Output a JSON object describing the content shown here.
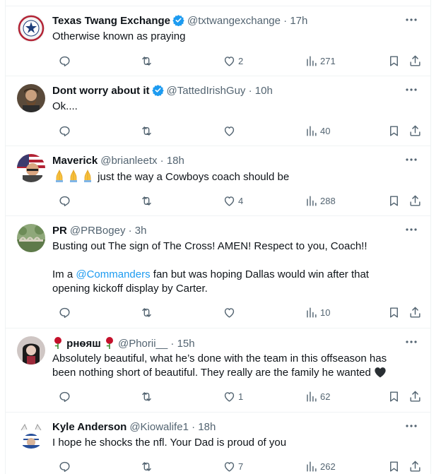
{
  "accent_color": "#1d9bf0",
  "tweets": [
    {
      "name": "Texas Twang Exchange",
      "handle": "@txtwangexchange",
      "time": "17h",
      "verified": true,
      "text": [
        "Otherwise known as praying"
      ],
      "replies": "",
      "retweets": "",
      "likes": "2",
      "views": "271"
    },
    {
      "name": "Dont worry about it",
      "handle": "@TattedIrishGuy",
      "time": "10h",
      "verified": true,
      "text": [
        "Ok...."
      ],
      "replies": "",
      "retweets": "",
      "likes": "",
      "views": "40"
    },
    {
      "name": "Maverick",
      "handle": "@brianleetx",
      "time": "18h",
      "verified": false,
      "text": [
        "just the way a Cowboys coach should be"
      ],
      "replies": "",
      "retweets": "",
      "likes": "4",
      "views": "288"
    },
    {
      "name": "PR",
      "handle": "@PRBogey",
      "time": "3h",
      "verified": false,
      "text": [
        "Busting out The sign of The Cross! AMEN!  Respect to you, Coach!!",
        "Im a",
        "@Commanders",
        "fan but was hoping Dallas would win after that",
        "opening kickoff display by Carter."
      ],
      "replies": "",
      "retweets": "",
      "likes": "",
      "views": "10"
    },
    {
      "name": "рнѳяш",
      "handle": "@Phorii__",
      "time": "15h",
      "verified": false,
      "text": [
        "Absolutely beautiful, what he’s done with the team in this offseason has",
        "been nothing short of beautiful. They really are the family he wanted"
      ],
      "replies": "",
      "retweets": "",
      "likes": "1",
      "views": "62"
    },
    {
      "name": "Kyle Anderson",
      "handle": "@Kiowalife1",
      "time": "18h",
      "verified": false,
      "text": [
        "I hope he shocks the nfl. Your Dad is proud of you"
      ],
      "replies": "",
      "retweets": "",
      "likes": "7",
      "views": "262"
    }
  ]
}
